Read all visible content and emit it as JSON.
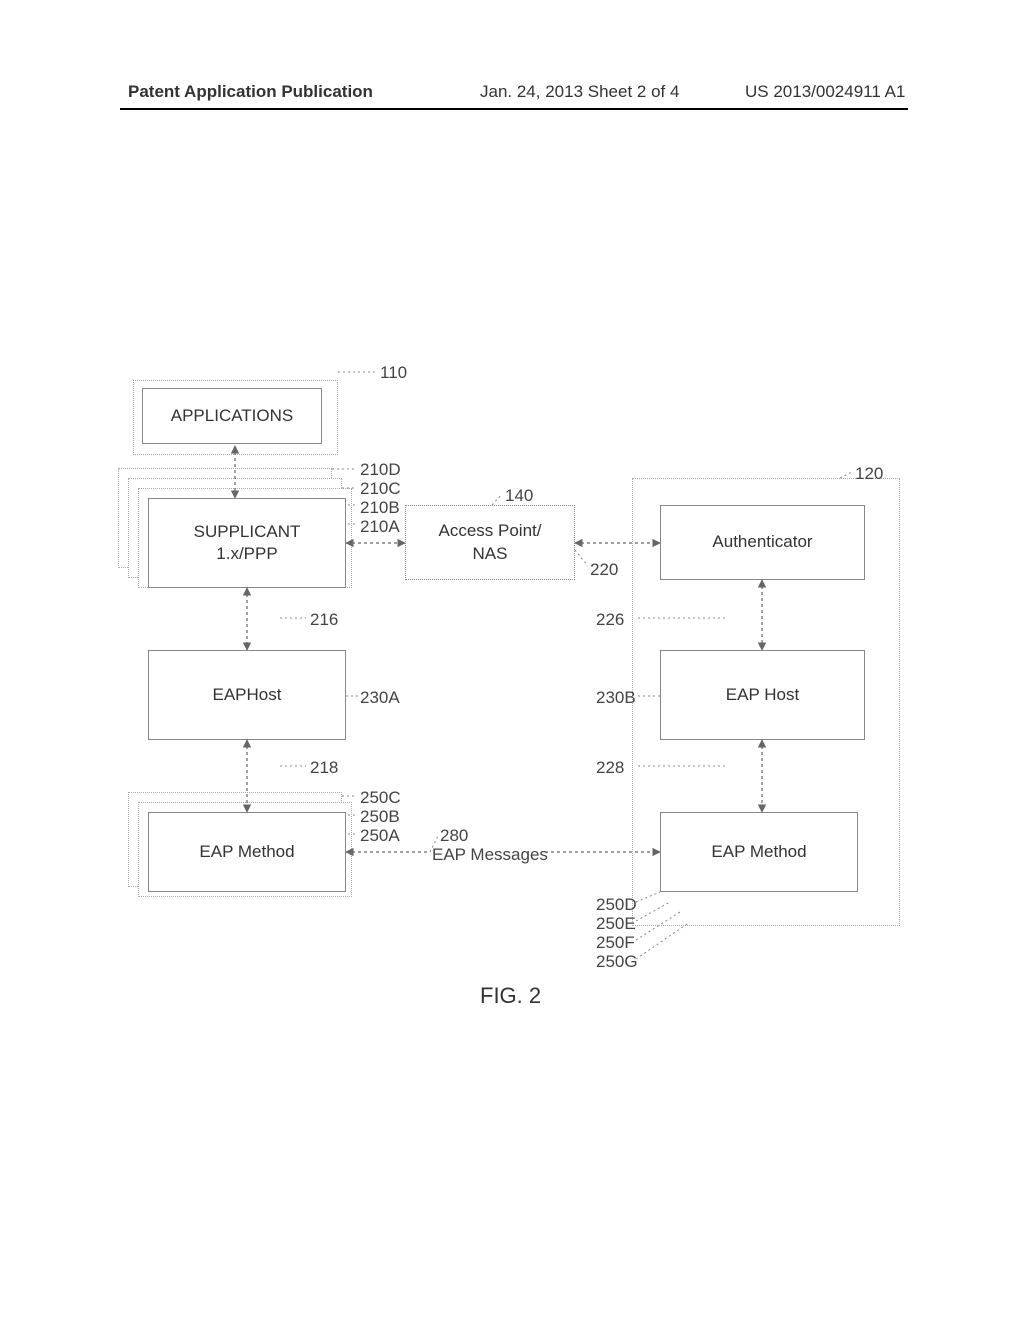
{
  "header": {
    "left": "Patent Application Publication",
    "center": "Jan. 24, 2013  Sheet 2 of 4",
    "right": "US 2013/0024911 A1"
  },
  "boxes": {
    "applications": "APPLICATIONS",
    "supplicant": "SUPPLICANT\n1.x/PPP",
    "access_point": "Access Point/\nNAS",
    "authenticator": "Authenticator",
    "eaphost_left": "EAPHost",
    "eaphost_right": "EAP Host",
    "eap_method_left": "EAP Method",
    "eap_method_right": "EAP Method",
    "eap_messages": "EAP Messages"
  },
  "labels": {
    "l110": "110",
    "l210a": "210A",
    "l210b": "210B",
    "l210c": "210C",
    "l210d": "210D",
    "l140": "140",
    "l120": "120",
    "l220": "220",
    "l216": "216",
    "l226": "226",
    "l230a": "230A",
    "l230b": "230B",
    "l218": "218",
    "l228": "228",
    "l250a": "250A",
    "l250b": "250B",
    "l250c": "250C",
    "l250d": "250D",
    "l250e": "250E",
    "l250f": "250F",
    "l250g": "250G",
    "l280": "280"
  },
  "figure_caption": "FIG. 2",
  "chart_data": {
    "type": "diagram",
    "title": "FIG. 2",
    "nodes": [
      {
        "id": "110",
        "label": "APPLICATIONS"
      },
      {
        "id": "210A",
        "label": "SUPPLICANT 1.x/PPP"
      },
      {
        "id": "210B",
        "label": "SUPPLICANT (stack)"
      },
      {
        "id": "210C",
        "label": "SUPPLICANT (stack)"
      },
      {
        "id": "210D",
        "label": "SUPPLICANT (stack)"
      },
      {
        "id": "140",
        "label": "Access Point/NAS"
      },
      {
        "id": "120",
        "label": "Authenticator container"
      },
      {
        "id": "220",
        "label": "Authenticator"
      },
      {
        "id": "230A",
        "label": "EAPHost (client)"
      },
      {
        "id": "230B",
        "label": "EAP Host (server)"
      },
      {
        "id": "250A",
        "label": "EAP Method (client)"
      },
      {
        "id": "250B",
        "label": "EAP Method (client stack)"
      },
      {
        "id": "250C",
        "label": "EAP Method (client stack)"
      },
      {
        "id": "250D",
        "label": "EAP Method (server)"
      },
      {
        "id": "250E",
        "label": "EAP Method (server stack)"
      },
      {
        "id": "250F",
        "label": "EAP Method (server stack)"
      },
      {
        "id": "250G",
        "label": "EAP Method (server stack)"
      },
      {
        "id": "280",
        "label": "EAP Messages"
      }
    ],
    "edges": [
      {
        "from": "110",
        "to": "210A",
        "bidirectional": true
      },
      {
        "from": "210A",
        "to": "140",
        "bidirectional": true,
        "via": "220"
      },
      {
        "from": "140",
        "to": "220",
        "bidirectional": true
      },
      {
        "from": "210A",
        "to": "230A",
        "bidirectional": true,
        "label": "216"
      },
      {
        "from": "220",
        "to": "230B",
        "bidirectional": true,
        "label": "226"
      },
      {
        "from": "230A",
        "to": "250A",
        "bidirectional": true,
        "label": "218"
      },
      {
        "from": "230B",
        "to": "250D",
        "bidirectional": true,
        "label": "228"
      },
      {
        "from": "250A",
        "to": "250D",
        "bidirectional": true,
        "label": "280 EAP Messages"
      }
    ]
  }
}
